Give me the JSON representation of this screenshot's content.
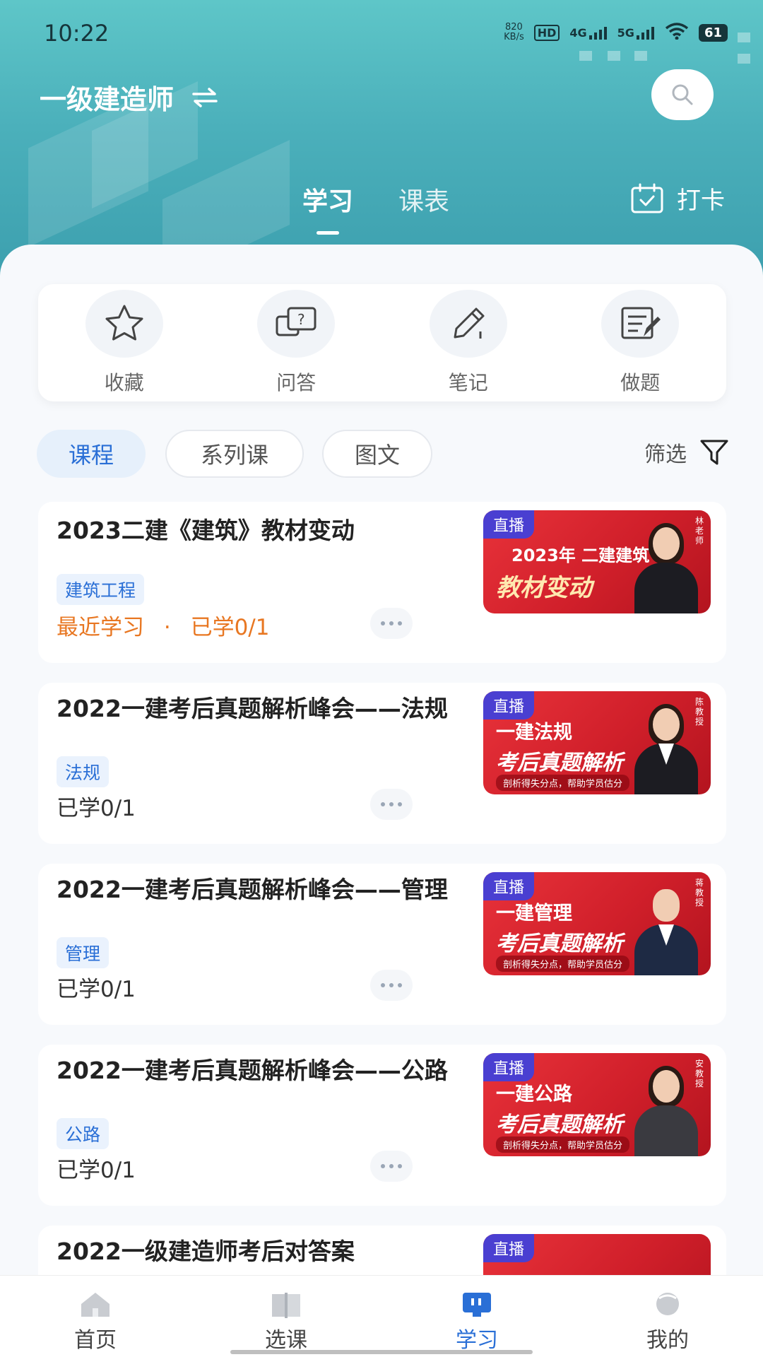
{
  "status_bar": {
    "time": "10:22",
    "net_speed_value": "820",
    "net_speed_unit": "KB/s",
    "hd": "HD",
    "sig1": "4G",
    "sig2": "5G",
    "battery": "61"
  },
  "header": {
    "exam_title": "一级建造师",
    "tabs": [
      {
        "label": "学习",
        "active": true
      },
      {
        "label": "课表",
        "active": false
      }
    ],
    "checkin_label": "打卡"
  },
  "quick_actions": [
    {
      "label": "收藏",
      "icon": "star-icon"
    },
    {
      "label": "问答",
      "icon": "qa-icon"
    },
    {
      "label": "笔记",
      "icon": "pencil-icon"
    },
    {
      "label": "做题",
      "icon": "exercise-icon"
    }
  ],
  "filters": {
    "chips": [
      {
        "label": "课程",
        "active": true
      },
      {
        "label": "系列课",
        "active": false
      },
      {
        "label": "图文",
        "active": false
      }
    ],
    "filter_label": "筛选"
  },
  "courses": [
    {
      "title": "2023二建《建筑》教材变动",
      "tag": "建筑工程",
      "recent": "最近学习",
      "separator": "·",
      "progress": "已学0/1",
      "thumb": {
        "live": "直播",
        "line1": "2023年 二建建筑",
        "line2": "教材变动",
        "line3": "",
        "sign": "林老师"
      }
    },
    {
      "title": "2022一建考后真题解析峰会——法规",
      "tag": "法规",
      "progress": "已学0/1",
      "thumb": {
        "live": "直播",
        "line1": "一建法规",
        "line2": "考后真题解析",
        "line3": "剖析得失分点，帮助学员估分",
        "sign": "陈教授"
      }
    },
    {
      "title": "2022一建考后真题解析峰会——管理",
      "tag": "管理",
      "progress": "已学0/1",
      "thumb": {
        "live": "直播",
        "line1": "一建管理",
        "line2": "考后真题解析",
        "line3": "剖析得失分点，帮助学员估分",
        "sign": "蒋教授"
      }
    },
    {
      "title": "2022一建考后真题解析峰会——公路",
      "tag": "公路",
      "progress": "已学0/1",
      "thumb": {
        "live": "直播",
        "line1": "一建公路",
        "line2": "考后真题解析",
        "line3": "剖析得失分点，帮助学员估分",
        "sign": "安教授"
      }
    },
    {
      "title": "2022一级建造师考后对答案",
      "thumb": {
        "live": "直播"
      }
    }
  ],
  "tabbar": [
    {
      "label": "首页",
      "icon": "home-icon",
      "active": false
    },
    {
      "label": "选课",
      "icon": "book-icon",
      "active": false
    },
    {
      "label": "学习",
      "icon": "study-icon",
      "active": true
    },
    {
      "label": "我的",
      "icon": "profile-icon",
      "active": false
    }
  ],
  "colors": {
    "accent": "#2a6fd6",
    "recent": "#e87722",
    "header": "#4bb0bb",
    "live_badge": "#4a3fd1",
    "thumb_red": "#d01f2a"
  }
}
